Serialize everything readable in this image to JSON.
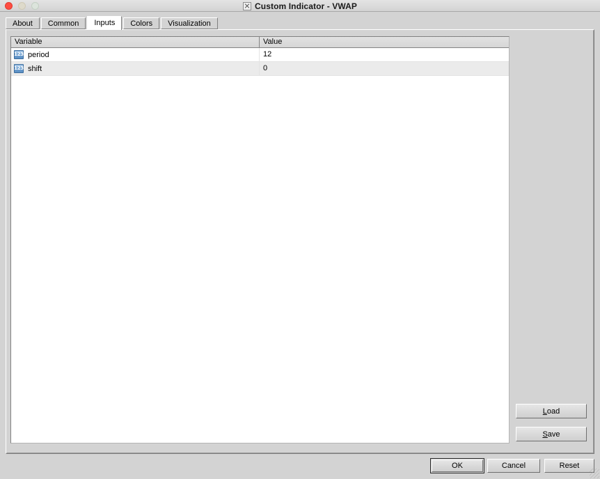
{
  "window": {
    "title": "Custom Indicator - VWAP",
    "icon": "x-square-icon",
    "controls": {
      "close": "close-button",
      "minimize": "minimize-button",
      "maximize": "maximize-button"
    }
  },
  "tabs": [
    {
      "label": "About",
      "active": false
    },
    {
      "label": "Common",
      "active": false
    },
    {
      "label": "Inputs",
      "active": true
    },
    {
      "label": "Colors",
      "active": false
    },
    {
      "label": "Visualization",
      "active": false
    }
  ],
  "table": {
    "columns": [
      "Variable",
      "Value"
    ],
    "rows": [
      {
        "icon": "integer-type-icon",
        "icon_text": "123",
        "variable": "period",
        "value": "12"
      },
      {
        "icon": "integer-type-icon",
        "icon_text": "123",
        "variable": "shift",
        "value": "0"
      }
    ]
  },
  "side_buttons": {
    "load": {
      "mnemonic": "L",
      "rest": "oad"
    },
    "save": {
      "mnemonic": "S",
      "rest": "ave"
    }
  },
  "footer_buttons": {
    "ok": "OK",
    "cancel": "Cancel",
    "reset": "Reset"
  },
  "colors": {
    "window_background": "#d3d3d3",
    "table_background": "#ffffff",
    "row_alt_background": "#ebebeb",
    "header_background": "#d9d9d9",
    "type_icon_blue": "#6d9fd0",
    "close_button_red": "#ff4d42"
  }
}
